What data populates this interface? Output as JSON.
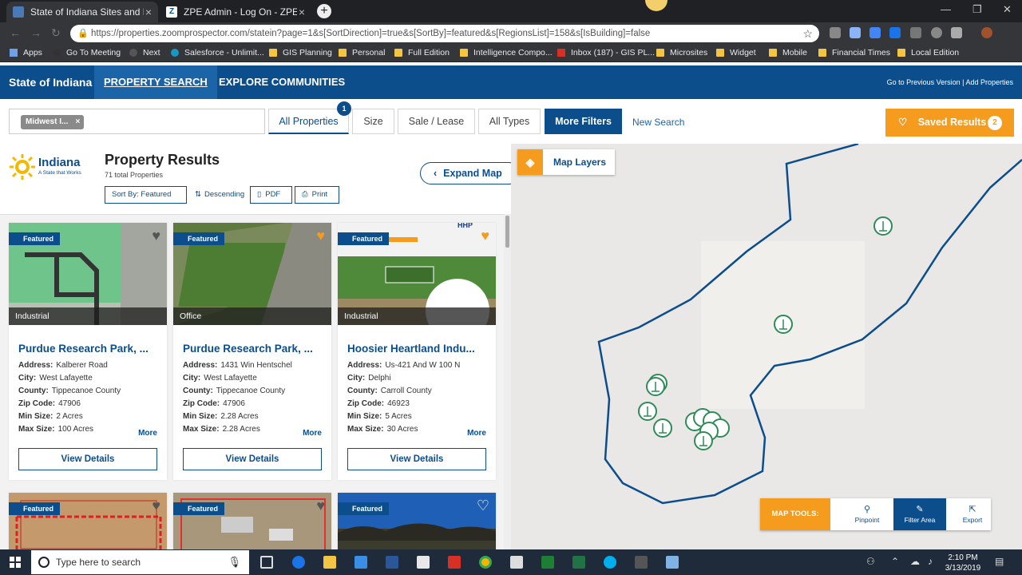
{
  "browser": {
    "tabs": [
      {
        "title": "State of Indiana Sites and Buildin"
      },
      {
        "title": "ZPE Admin - Log On - ZPEAdmin"
      }
    ],
    "url": "https://properties.zoomprospector.com/statein?page=1&s[SortDirection]=true&s[SortBy]=featured&s[RegionsList]=158&s[IsBuilding]=false",
    "bookmarks": [
      "Apps",
      "Go To Meeting",
      "Next",
      "Salesforce - Unlimit...",
      "GIS Planning",
      "Personal",
      "Full Edition",
      "Intelligence Compo...",
      "Inbox (187) - GIS PL...",
      "Microsites",
      "Widget",
      "Mobile",
      "Financial Times",
      "Local Edition"
    ]
  },
  "site_nav": {
    "brand": "State of Indiana",
    "items": [
      "PROPERTY SEARCH",
      "EXPLORE COMMUNITIES"
    ],
    "right_links": "Go to Previous Version  |  Add Properties"
  },
  "filters": {
    "chip": "Midwest I...",
    "buttons": [
      "All Properties",
      "Size",
      "Sale / Lease",
      "All Types",
      "More Filters"
    ],
    "badge": "1",
    "new_search": "New Search",
    "saved_results": "Saved Results",
    "saved_count": "2"
  },
  "results": {
    "logo_name": "Indiana",
    "logo_tag": "A State that Works",
    "title": "Property Results",
    "count": "71 total Properties",
    "sort_label": "Sort By: Featured",
    "descending": "Descending",
    "pdf": "PDF",
    "print": "Print",
    "expand_map": "Expand Map"
  },
  "labels": {
    "address": "Address:",
    "city": "City:",
    "county": "County:",
    "zip": "Zip Code:",
    "min": "Min Size:",
    "max": "Max Size:",
    "more": "More",
    "view": "View Details",
    "featured": "Featured"
  },
  "cards": [
    {
      "category": "Industrial",
      "name": "Purdue Research Park, ...",
      "address": "Kalberer Road",
      "city": "West Lafayette",
      "county": "Tippecanoe County",
      "zip": "47906",
      "min": "2 Acres",
      "max": "100 Acres"
    },
    {
      "category": "Office",
      "name": "Purdue Research Park, ...",
      "address": "1431 Win Hentschel",
      "city": "West Lafayette",
      "county": "Tippecanoe County",
      "zip": "47906",
      "min": "2.28 Acres",
      "max": "2.28 Acres"
    },
    {
      "category": "Industrial",
      "name": "Hoosier Heartland Indu...",
      "address": "Us-421 And W 100 N",
      "city": "Delphi",
      "county": "Carroll County",
      "zip": "46923",
      "min": "5 Acres",
      "max": "30 Acres"
    }
  ],
  "map": {
    "layers": "Map Layers",
    "tools_label": "MAP TOOLS:",
    "tools": [
      "Pinpoint",
      "Filter Area",
      "Export"
    ]
  },
  "taskbar": {
    "search_placeholder": "Type here to search",
    "time": "2:10 PM",
    "date": "3/13/2019"
  },
  "colors": {
    "brand_blue": "#0c4d8c",
    "accent_orange": "#f59b1d",
    "pin_green": "#2e8b57"
  }
}
